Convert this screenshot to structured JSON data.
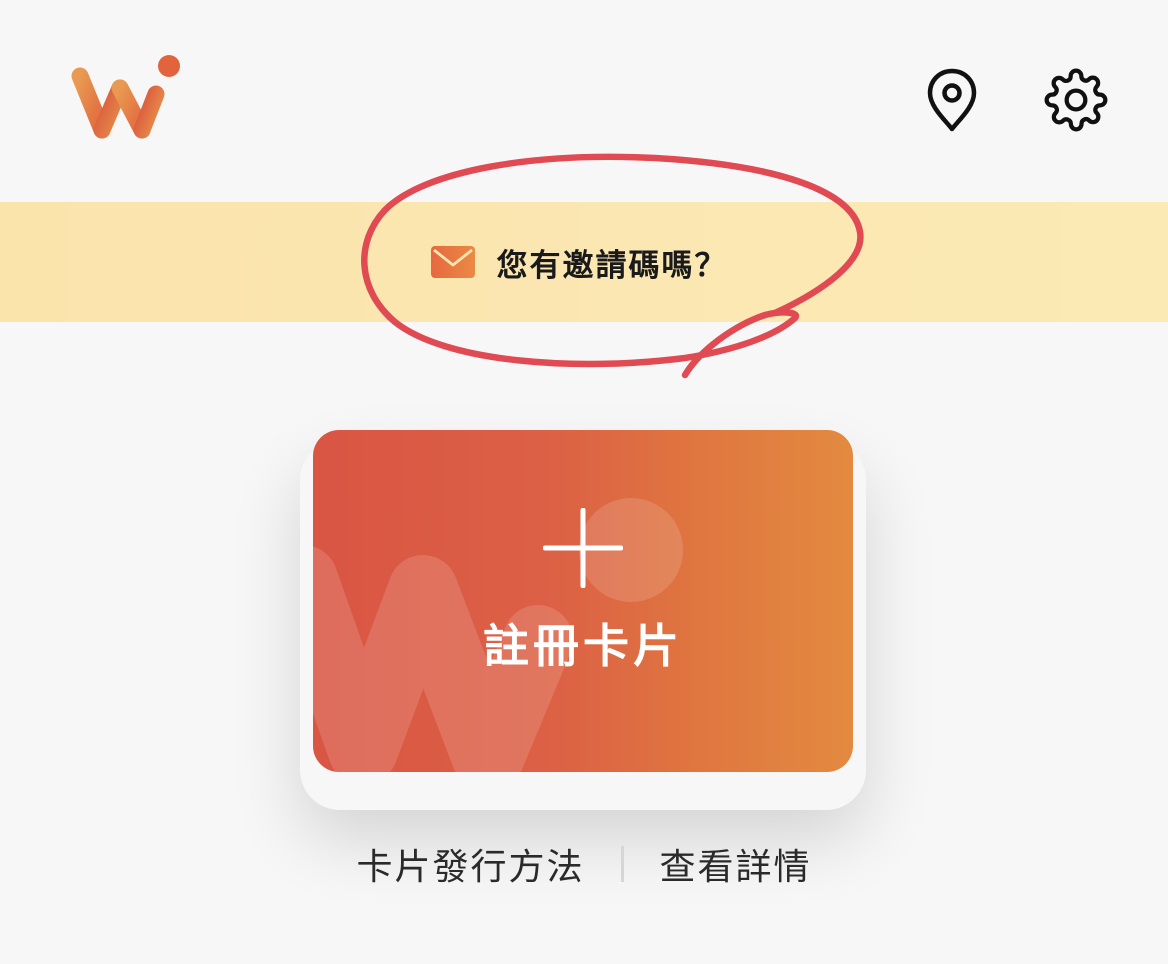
{
  "header": {
    "logo_icon": "wi-logo-icon",
    "location_icon": "map-pin-icon",
    "settings_icon": "gear-icon"
  },
  "invite_banner": {
    "icon": "envelope-icon",
    "text": "您有邀請碼嗎？"
  },
  "register_card": {
    "icon": "plus-icon",
    "label": "註冊卡片"
  },
  "links": {
    "issue_method": "卡片發行方法",
    "details": "查看詳情"
  },
  "colors": {
    "brand_orange": "#e0793f",
    "brand_red": "#d95544",
    "banner_yellow": "#fbe5ae",
    "annotation_red": "#e04a52"
  }
}
